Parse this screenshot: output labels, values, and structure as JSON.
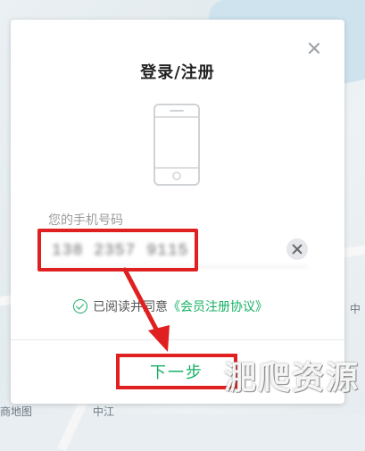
{
  "dialog": {
    "title": "登录/注册",
    "phone_label": "您的手机号码",
    "phone_value": "138 2357 9115",
    "agreement_prefix": "已阅读并同意",
    "agreement_link": "《会员注册协议》",
    "next_label": "下一步"
  },
  "background": {
    "map_text_left": "商地图",
    "map_text_mid": "中江",
    "map_text_right": "中"
  },
  "watermark": "淝爬资源",
  "colors": {
    "accent_green": "#16b064",
    "annotation_red": "#e02020"
  }
}
